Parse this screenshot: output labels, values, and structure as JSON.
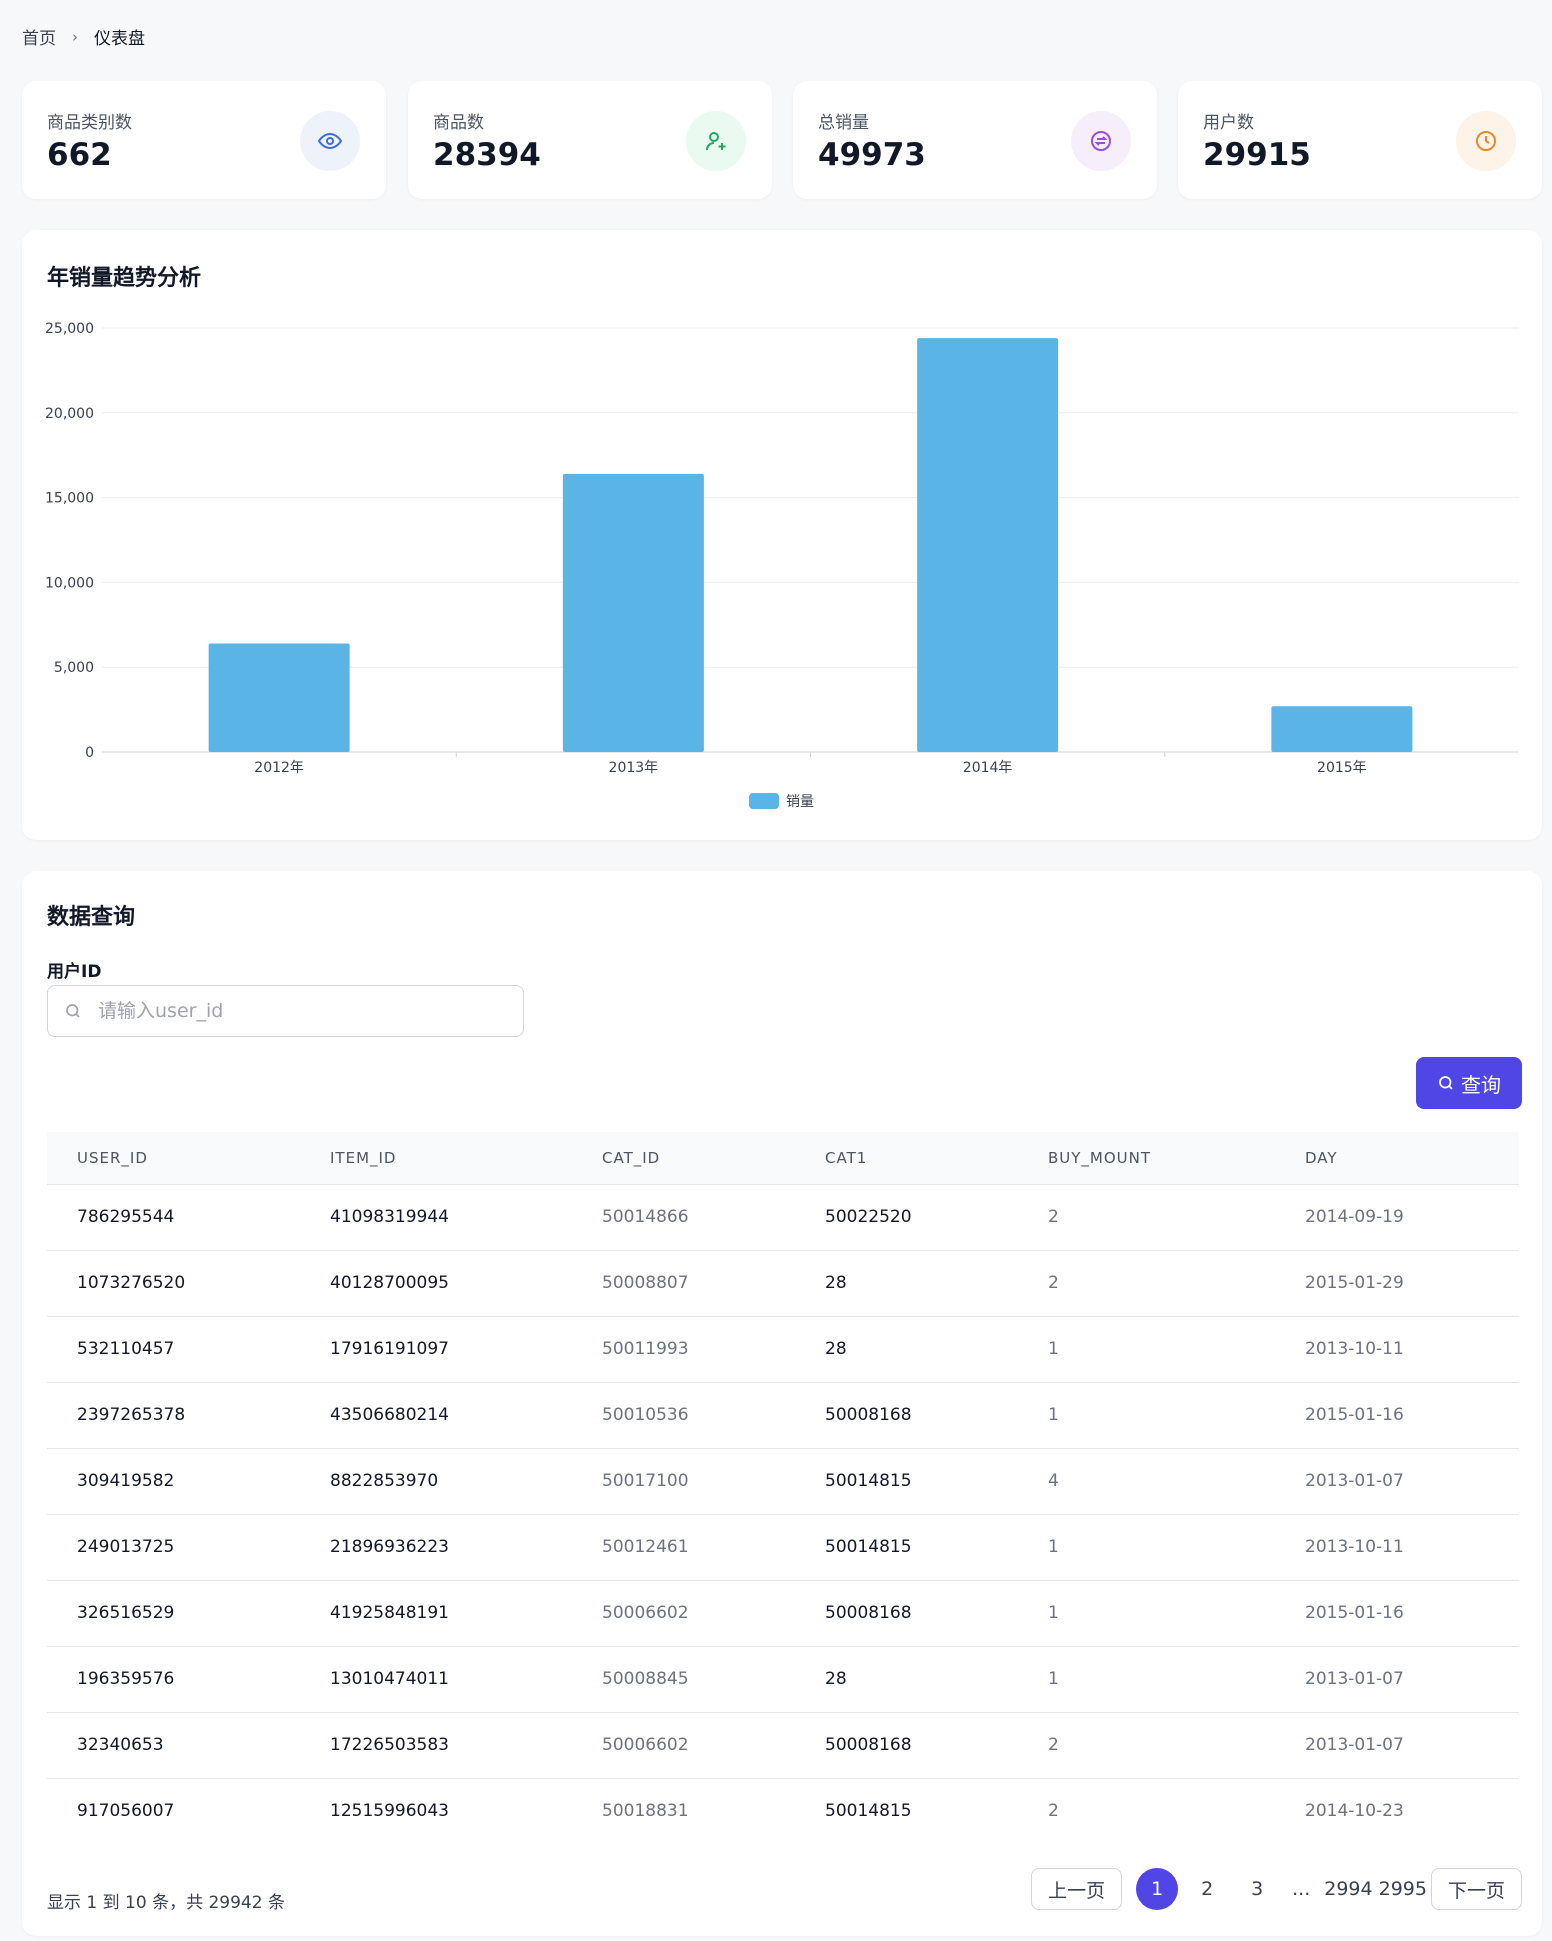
{
  "breadcrumb": {
    "home": "首页",
    "current": "仪表盘"
  },
  "stats": [
    {
      "label": "商品类别数",
      "value": "662",
      "icon": "eye-icon",
      "bg": "#eef2fb",
      "color": "#3b6fd8"
    },
    {
      "label": "商品数",
      "value": "28394",
      "icon": "user-plus-icon",
      "bg": "#ebfaf1",
      "color": "#22a861"
    },
    {
      "label": "总销量",
      "value": "49973",
      "icon": "exchange-icon",
      "bg": "#f7eefc",
      "color": "#9b4fd6"
    },
    {
      "label": "用户数",
      "value": "29915",
      "icon": "clock-icon",
      "bg": "#fdf3e8",
      "color": "#e08a2b"
    }
  ],
  "chart": {
    "title": "年销量趋势分析"
  },
  "chart_data": {
    "type": "bar",
    "categories": [
      "2012年",
      "2013年",
      "2014年",
      "2015年"
    ],
    "series": [
      {
        "name": "销量",
        "values": [
          6400,
          16400,
          24400,
          2700
        ]
      }
    ],
    "ylim": [
      0,
      25000
    ],
    "yticks": [
      "0",
      "5,000",
      "10,000",
      "15,000",
      "20,000",
      "25,000"
    ],
    "color": "#5ab4e5",
    "grid": true,
    "legend": "bottom-center"
  },
  "query": {
    "title": "数据查询",
    "field_label": "用户ID",
    "placeholder": "请输入user_id",
    "value": "",
    "button_label": "查询",
    "button_color": "#4f46e5"
  },
  "table": {
    "headers": [
      "USER_ID",
      "ITEM_ID",
      "CAT_ID",
      "CAT1",
      "BUY_MOUNT",
      "DAY"
    ],
    "rows": [
      [
        "786295544",
        "41098319944",
        "50014866",
        "50022520",
        "2",
        "2014-09-19"
      ],
      [
        "1073276520",
        "40128700095",
        "50008807",
        "28",
        "2",
        "2015-01-29"
      ],
      [
        "532110457",
        "17916191097",
        "50011993",
        "28",
        "1",
        "2013-10-11"
      ],
      [
        "2397265378",
        "43506680214",
        "50010536",
        "50008168",
        "1",
        "2015-01-16"
      ],
      [
        "309419582",
        "8822853970",
        "50017100",
        "50014815",
        "4",
        "2013-01-07"
      ],
      [
        "249013725",
        "21896936223",
        "50012461",
        "50014815",
        "1",
        "2013-10-11"
      ],
      [
        "326516529",
        "41925848191",
        "50006602",
        "50008168",
        "1",
        "2015-01-16"
      ],
      [
        "196359576",
        "13010474011",
        "50008845",
        "28",
        "1",
        "2013-01-07"
      ],
      [
        "32340653",
        "17226503583",
        "50006602",
        "50008168",
        "2",
        "2013-01-07"
      ],
      [
        "917056007",
        "12515996043",
        "50018831",
        "50014815",
        "2",
        "2014-10-23"
      ]
    ]
  },
  "pagination": {
    "info": "显示 1 到 10 条，共 29942 条",
    "prev": "上一页",
    "next": "下一页",
    "pages": [
      "1",
      "2",
      "3"
    ],
    "ellipsis": "...",
    "last_pages": "2994 2995",
    "active": "1"
  }
}
